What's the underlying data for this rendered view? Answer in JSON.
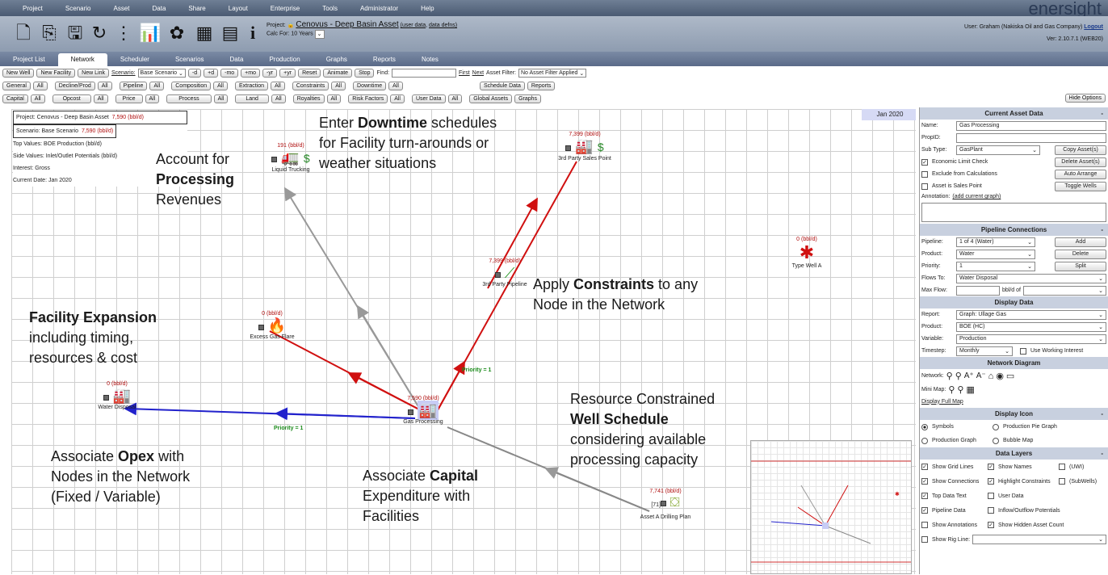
{
  "brand": "enersight",
  "menu": [
    "Project",
    "Scenario",
    "Asset",
    "Data",
    "Share",
    "Layout",
    "Enterprise",
    "Tools",
    "Administrator",
    "Help"
  ],
  "project": {
    "label": "Project:",
    "name": "Cenovus - Deep Basin Asset",
    "user_data": "(user data",
    "data_defns": "data defns)",
    "calc_label": "Calc For: 10 Years"
  },
  "user": {
    "text": "User: Graham (Nakiska Oil and Gas Company)",
    "logout": "Logout",
    "version": "Ver: 2.10.7.1 (WEB20)"
  },
  "tabs": [
    "Project List",
    "Network",
    "Scheduler",
    "Scenarios",
    "Data",
    "Production",
    "Graphs",
    "Reports",
    "Notes"
  ],
  "row1": {
    "new_well": "New Well",
    "new_facility": "New Facility",
    "new_link": "New Link",
    "scenario_label": "Scenario:",
    "scenario_value": "Base Scenario",
    "d": "-d",
    "pd": "+d",
    "mo": "-mo",
    "pmo": "+mo",
    "yr": "-yr",
    "pyr": "+yr",
    "reset": "Reset",
    "animate": "Animate",
    "stop": "Stop",
    "find": "Find:",
    "first": "First",
    "next": "Next",
    "asset_filter_label": "Asset Filter:",
    "asset_filter_value": "No Asset Filter Applied"
  },
  "row2": [
    "General",
    "Decline/Prod",
    "Pipeline",
    "Composition",
    "Extraction",
    "Constraints",
    "Downtime",
    "Schedule Data",
    "Reports"
  ],
  "row3": [
    "Capital",
    "Opcost",
    "Price",
    "Process",
    "Land",
    "Royalties",
    "Risk Factors",
    "User Data",
    "Global Assets",
    "Graphs"
  ],
  "all": "All",
  "hide_options": "Hide Options",
  "info": {
    "project": "Project: Cenovus - Deep Basin Asset",
    "project_val": "7,590 (bbl/d)",
    "scenario": "Scenario: Base Scenario",
    "scenario_val": "7,590 (bbl/d)",
    "top": "Top Values: BOE Production (bbl/d)",
    "side": "Side Values: Inlet/Outlet Potentials (bbl/d)",
    "interest": "Interest: Gross",
    "date": "Current Date: Jan 2020"
  },
  "date_badge": "Jan 2020",
  "nodes": {
    "liquid_trucking": {
      "label": "Liquid Trucking",
      "value": "191 (bbl/d)"
    },
    "sales_point": {
      "label": "3rd Party Sales Point",
      "value": "7,399 (bbl/d)"
    },
    "pipeline": {
      "label": "3rd Party Pipeline",
      "value": "7,399 (bbl/d)"
    },
    "type_well": {
      "label": "Type Well A",
      "value": "0 (bbl/d)"
    },
    "flare": {
      "label": "Excess Gas Flare",
      "value": "0 (bbl/d)"
    },
    "water": {
      "label": "Water Disposal",
      "value": "0 (bbl/d)"
    },
    "gas_processing": {
      "label": "Gas Processing",
      "value": "7,590 (bbl/d)"
    },
    "drilling": {
      "label": "Asset A Drilling Plan",
      "value": "7,741 (bbl/d)",
      "count": "[71]"
    }
  },
  "priority": "Priority = 1",
  "annotations": {
    "processing": [
      "Account for",
      "Processing",
      "Revenues"
    ],
    "downtime": [
      "Enter ",
      "Downtime",
      " schedules",
      "for Facility turn-arounds or",
      "weather situations"
    ],
    "constraints": [
      "Apply ",
      "Constraints",
      " to any",
      "Node in the Network"
    ],
    "expansion": [
      "Facility Expansion",
      "including timing,",
      "resources & cost"
    ],
    "opex": [
      "Associate ",
      "Opex",
      " with",
      "Nodes in the Network",
      "(Fixed / Variable)"
    ],
    "capital": [
      "Associate ",
      "Capital",
      "Expenditure with",
      "Facilities"
    ],
    "well": [
      "Resource Constrained",
      "Well Schedule",
      "considering available",
      "processing capacity"
    ]
  },
  "panel": {
    "current_asset": "Current Asset Data",
    "name_label": "Name:",
    "name_value": "Gas Processing",
    "propid_label": "PropID:",
    "subtype_label": "Sub Type:",
    "subtype_value": "GasPlant",
    "copy": "Copy Asset(s)",
    "delete_asset": "Delete Asset(s)",
    "auto_arrange": "Auto Arrange",
    "toggle_wells": "Toggle Wells",
    "econ": "Economic Limit Check",
    "exclude": "Exclude from Calculations",
    "sales": "Asset is Sales Point",
    "annotation_label": "Annotation:",
    "annotation_link": "(add current graph)",
    "pipeline_conn": "Pipeline Connections",
    "pipeline_label": "Pipeline:",
    "pipeline_value": "1 of 4 (Water)",
    "add": "Add",
    "product_label": "Product:",
    "product_value": "Water",
    "delete": "Delete",
    "priority_label": "Priority:",
    "priority_value": "1",
    "split": "Split",
    "flows_label": "Flows To:",
    "flows_value": "Water Disposal",
    "maxflow_label": "Max Flow:",
    "bbld_of": "bbl/d of",
    "display_data": "Display Data",
    "report_label": "Report:",
    "report_value": "Graph: Ullage Gas",
    "dproduct_label": "Product:",
    "dproduct_value": "BOE (HC)",
    "variable_label": "Variable:",
    "variable_value": "Production",
    "timestep_label": "Timestep:",
    "timestep_value": "Monthly",
    "use_wi": "Use Working Interest",
    "network_diagram": "Network Diagram",
    "network_label": "Network:",
    "minimap_label": "Mini Map:",
    "display_full": "Display Full Map",
    "display_icon": "Display Icon",
    "symbols": "Symbols",
    "pie": "Production Pie Graph",
    "prod_graph": "Production Graph",
    "bubble": "Bubble Map",
    "data_layers": "Data Layers",
    "grid": "Show Grid Lines",
    "names": "Show Names",
    "uwi": "(UWI)",
    "connections": "Show Connections",
    "highlight": "Highlight Constraints",
    "subwells": "(SubWells)",
    "top_text": "Top Data Text",
    "user_data": "User Data",
    "pipeline_data": "Pipeline Data",
    "inout": "Inflow/Outflow Potentials",
    "show_annotations": "Show Annotations",
    "hidden_count": "Show Hidden Asset Count",
    "rig_line": "Show Rig Line:"
  }
}
